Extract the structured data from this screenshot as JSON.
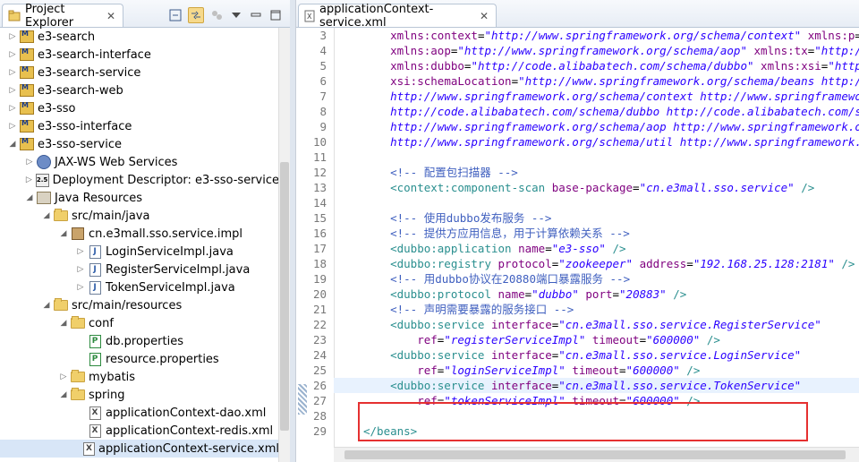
{
  "explorer": {
    "title": "Project Explorer",
    "close_glyph": "✕",
    "items": [
      {
        "label": "e3-search",
        "depth": 0,
        "arrow": "▷",
        "icon": "maven-project-icon"
      },
      {
        "label": "e3-search-interface",
        "depth": 0,
        "arrow": "▷",
        "icon": "maven-project-icon"
      },
      {
        "label": "e3-search-service",
        "depth": 0,
        "arrow": "▷",
        "icon": "maven-project-icon"
      },
      {
        "label": "e3-search-web",
        "depth": 0,
        "arrow": "▷",
        "icon": "maven-project-icon"
      },
      {
        "label": "e3-sso",
        "depth": 0,
        "arrow": "▷",
        "icon": "maven-project-icon"
      },
      {
        "label": "e3-sso-interface",
        "depth": 0,
        "arrow": "▷",
        "icon": "maven-project-icon"
      },
      {
        "label": "e3-sso-service",
        "depth": 0,
        "arrow": "◢",
        "icon": "maven-project-icon"
      },
      {
        "label": "JAX-WS Web Services",
        "depth": 1,
        "arrow": "▷",
        "icon": "webservice-icon"
      },
      {
        "label": "Deployment Descriptor: e3-sso-service",
        "depth": 1,
        "arrow": "▷",
        "icon": "deployment-descriptor-icon"
      },
      {
        "label": "Java Resources",
        "depth": 1,
        "arrow": "◢",
        "icon": "java-resources-icon"
      },
      {
        "label": "src/main/java",
        "depth": 2,
        "arrow": "◢",
        "icon": "source-folder-icon"
      },
      {
        "label": "cn.e3mall.sso.service.impl",
        "depth": 3,
        "arrow": "◢",
        "icon": "package-icon"
      },
      {
        "label": "LoginServiceImpl.java",
        "depth": 4,
        "arrow": "▷",
        "icon": "java-file-icon"
      },
      {
        "label": "RegisterServiceImpl.java",
        "depth": 4,
        "arrow": "▷",
        "icon": "java-file-icon"
      },
      {
        "label": "TokenServiceImpl.java",
        "depth": 4,
        "arrow": "▷",
        "icon": "java-file-icon"
      },
      {
        "label": "src/main/resources",
        "depth": 2,
        "arrow": "◢",
        "icon": "source-folder-icon"
      },
      {
        "label": "conf",
        "depth": 3,
        "arrow": "◢",
        "icon": "folder-icon"
      },
      {
        "label": "db.properties",
        "depth": 4,
        "arrow": "",
        "icon": "properties-file-icon"
      },
      {
        "label": "resource.properties",
        "depth": 4,
        "arrow": "",
        "icon": "properties-file-icon"
      },
      {
        "label": "mybatis",
        "depth": 3,
        "arrow": "▷",
        "icon": "folder-icon"
      },
      {
        "label": "spring",
        "depth": 3,
        "arrow": "◢",
        "icon": "folder-icon"
      },
      {
        "label": "applicationContext-dao.xml",
        "depth": 4,
        "arrow": "",
        "icon": "xml-file-icon"
      },
      {
        "label": "applicationContext-redis.xml",
        "depth": 4,
        "arrow": "",
        "icon": "xml-file-icon"
      },
      {
        "label": "applicationContext-service.xml",
        "depth": 4,
        "arrow": "",
        "icon": "xml-file-icon",
        "selected": true
      }
    ]
  },
  "editor": {
    "tab_title": "applicationContext-service.xml",
    "close_glyph": "✕",
    "lines": [
      {
        "n": "3",
        "parts": [
          [
            "eq",
            "    "
          ],
          [
            "an",
            "xmlns:context"
          ],
          [
            "eq",
            "="
          ],
          [
            "av",
            "\"http://www.springframework.org/schema/context\""
          ],
          [
            "eq",
            " "
          ],
          [
            "an",
            "xmlns:p"
          ],
          [
            "eq",
            "="
          ]
        ]
      },
      {
        "n": "4",
        "parts": [
          [
            "eq",
            "    "
          ],
          [
            "an",
            "xmlns:aop"
          ],
          [
            "eq",
            "="
          ],
          [
            "av",
            "\"http://www.springframework.org/schema/aop\""
          ],
          [
            "eq",
            " "
          ],
          [
            "an",
            "xmlns:tx"
          ],
          [
            "eq",
            "="
          ],
          [
            "av",
            "\"http:/"
          ]
        ]
      },
      {
        "n": "5",
        "parts": [
          [
            "eq",
            "    "
          ],
          [
            "an",
            "xmlns:dubbo"
          ],
          [
            "eq",
            "="
          ],
          [
            "av",
            "\"http://code.alibabatech.com/schema/dubbo\""
          ],
          [
            "eq",
            " "
          ],
          [
            "an",
            "xmlns:xsi"
          ],
          [
            "eq",
            "="
          ],
          [
            "av",
            "\"http"
          ]
        ]
      },
      {
        "n": "6",
        "parts": [
          [
            "eq",
            "    "
          ],
          [
            "an",
            "xsi:schemaLocation"
          ],
          [
            "eq",
            "="
          ],
          [
            "av",
            "\"http://www.springframework.org/schema/beans http:/"
          ]
        ]
      },
      {
        "n": "7",
        "parts": [
          [
            "av",
            "    http://www.springframework.org/schema/context http://www.springframewo"
          ]
        ]
      },
      {
        "n": "8",
        "parts": [
          [
            "av",
            "    http://code.alibabatech.com/schema/dubbo http://code.alibabatech.com/s"
          ]
        ]
      },
      {
        "n": "9",
        "parts": [
          [
            "av",
            "    http://www.springframework.org/schema/aop http://www.springframework.o"
          ]
        ]
      },
      {
        "n": "10",
        "parts": [
          [
            "av",
            "    http://www.springframework.org/schema/util http://www.springframework."
          ]
        ]
      },
      {
        "n": "11",
        "parts": [
          [
            "eq",
            ""
          ]
        ]
      },
      {
        "n": "12",
        "parts": [
          [
            "cm",
            "    <!-- 配置包扫描器 -->"
          ]
        ]
      },
      {
        "n": "13",
        "parts": [
          [
            "tg",
            "    <context:component-scan"
          ],
          [
            "eq",
            " "
          ],
          [
            "an",
            "base-package"
          ],
          [
            "eq",
            "="
          ],
          [
            "av",
            "\"cn.e3mall.sso.service\""
          ],
          [
            "eq",
            " "
          ],
          [
            "tg",
            "/>"
          ]
        ]
      },
      {
        "n": "14",
        "parts": [
          [
            "eq",
            ""
          ]
        ]
      },
      {
        "n": "15",
        "parts": [
          [
            "cm",
            "    <!-- 使用dubbo发布服务 -->"
          ]
        ]
      },
      {
        "n": "16",
        "parts": [
          [
            "cm",
            "    <!-- 提供方应用信息，用于计算依赖关系 -->"
          ]
        ]
      },
      {
        "n": "17",
        "parts": [
          [
            "tg",
            "    <dubbo:application"
          ],
          [
            "eq",
            " "
          ],
          [
            "an",
            "name"
          ],
          [
            "eq",
            "="
          ],
          [
            "av",
            "\"e3-sso\""
          ],
          [
            "eq",
            " "
          ],
          [
            "tg",
            "/>"
          ]
        ]
      },
      {
        "n": "18",
        "parts": [
          [
            "tg",
            "    <dubbo:registry"
          ],
          [
            "eq",
            " "
          ],
          [
            "an",
            "protocol"
          ],
          [
            "eq",
            "="
          ],
          [
            "av",
            "\"zookeeper\""
          ],
          [
            "eq",
            " "
          ],
          [
            "an",
            "address"
          ],
          [
            "eq",
            "="
          ],
          [
            "av",
            "\"192.168.25.128:2181\""
          ],
          [
            "eq",
            " "
          ],
          [
            "tg",
            "/>"
          ]
        ]
      },
      {
        "n": "19",
        "parts": [
          [
            "cm",
            "    <!-- 用dubbo协议在20880端口暴露服务 -->"
          ]
        ]
      },
      {
        "n": "20",
        "parts": [
          [
            "tg",
            "    <dubbo:protocol"
          ],
          [
            "eq",
            " "
          ],
          [
            "an",
            "name"
          ],
          [
            "eq",
            "="
          ],
          [
            "av",
            "\"dubbo\""
          ],
          [
            "eq",
            " "
          ],
          [
            "an",
            "port"
          ],
          [
            "eq",
            "="
          ],
          [
            "av",
            "\"20883\""
          ],
          [
            "eq",
            " "
          ],
          [
            "tg",
            "/>"
          ]
        ]
      },
      {
        "n": "21",
        "parts": [
          [
            "cm",
            "    <!-- 声明需要暴露的服务接口 -->"
          ]
        ]
      },
      {
        "n": "22",
        "parts": [
          [
            "tg",
            "    <dubbo:service"
          ],
          [
            "eq",
            " "
          ],
          [
            "an",
            "interface"
          ],
          [
            "eq",
            "="
          ],
          [
            "av",
            "\"cn.e3mall.sso.service.RegisterService\""
          ]
        ]
      },
      {
        "n": "23",
        "parts": [
          [
            "eq",
            "        "
          ],
          [
            "an",
            "ref"
          ],
          [
            "eq",
            "="
          ],
          [
            "av",
            "\"registerServiceImpl\""
          ],
          [
            "eq",
            " "
          ],
          [
            "an",
            "timeout"
          ],
          [
            "eq",
            "="
          ],
          [
            "av",
            "\"600000\""
          ],
          [
            "eq",
            " "
          ],
          [
            "tg",
            "/>"
          ]
        ]
      },
      {
        "n": "24",
        "parts": [
          [
            "tg",
            "    <dubbo:service"
          ],
          [
            "eq",
            " "
          ],
          [
            "an",
            "interface"
          ],
          [
            "eq",
            "="
          ],
          [
            "av",
            "\"cn.e3mall.sso.service.LoginService\""
          ]
        ]
      },
      {
        "n": "25",
        "parts": [
          [
            "eq",
            "        "
          ],
          [
            "an",
            "ref"
          ],
          [
            "eq",
            "="
          ],
          [
            "av",
            "\"loginServiceImpl\""
          ],
          [
            "eq",
            " "
          ],
          [
            "an",
            "timeout"
          ],
          [
            "eq",
            "="
          ],
          [
            "av",
            "\"600000\""
          ],
          [
            "eq",
            " "
          ],
          [
            "tg",
            "/>"
          ]
        ]
      },
      {
        "n": "26",
        "cur": true,
        "parts": [
          [
            "tg",
            "    <dubbo:service"
          ],
          [
            "eq",
            " "
          ],
          [
            "an",
            "interface"
          ],
          [
            "eq",
            "="
          ],
          [
            "av",
            "\"cn.e3mall.sso.service.TokenService\""
          ]
        ]
      },
      {
        "n": "27",
        "parts": [
          [
            "eq",
            "        "
          ],
          [
            "an",
            "ref"
          ],
          [
            "eq",
            "="
          ],
          [
            "av",
            "\"tokenServiceImpl\""
          ],
          [
            "eq",
            " "
          ],
          [
            "an",
            "timeout"
          ],
          [
            "eq",
            "="
          ],
          [
            "av",
            "\"600000\""
          ],
          [
            "eq",
            " "
          ],
          [
            "tg",
            "/>"
          ]
        ]
      },
      {
        "n": "28",
        "parts": [
          [
            "eq",
            ""
          ]
        ]
      },
      {
        "n": "29",
        "parts": [
          [
            "tg",
            "</beans>"
          ]
        ]
      }
    ]
  },
  "colors": {
    "highlight_box": "#e53030",
    "selection": "#d8e6f7"
  }
}
